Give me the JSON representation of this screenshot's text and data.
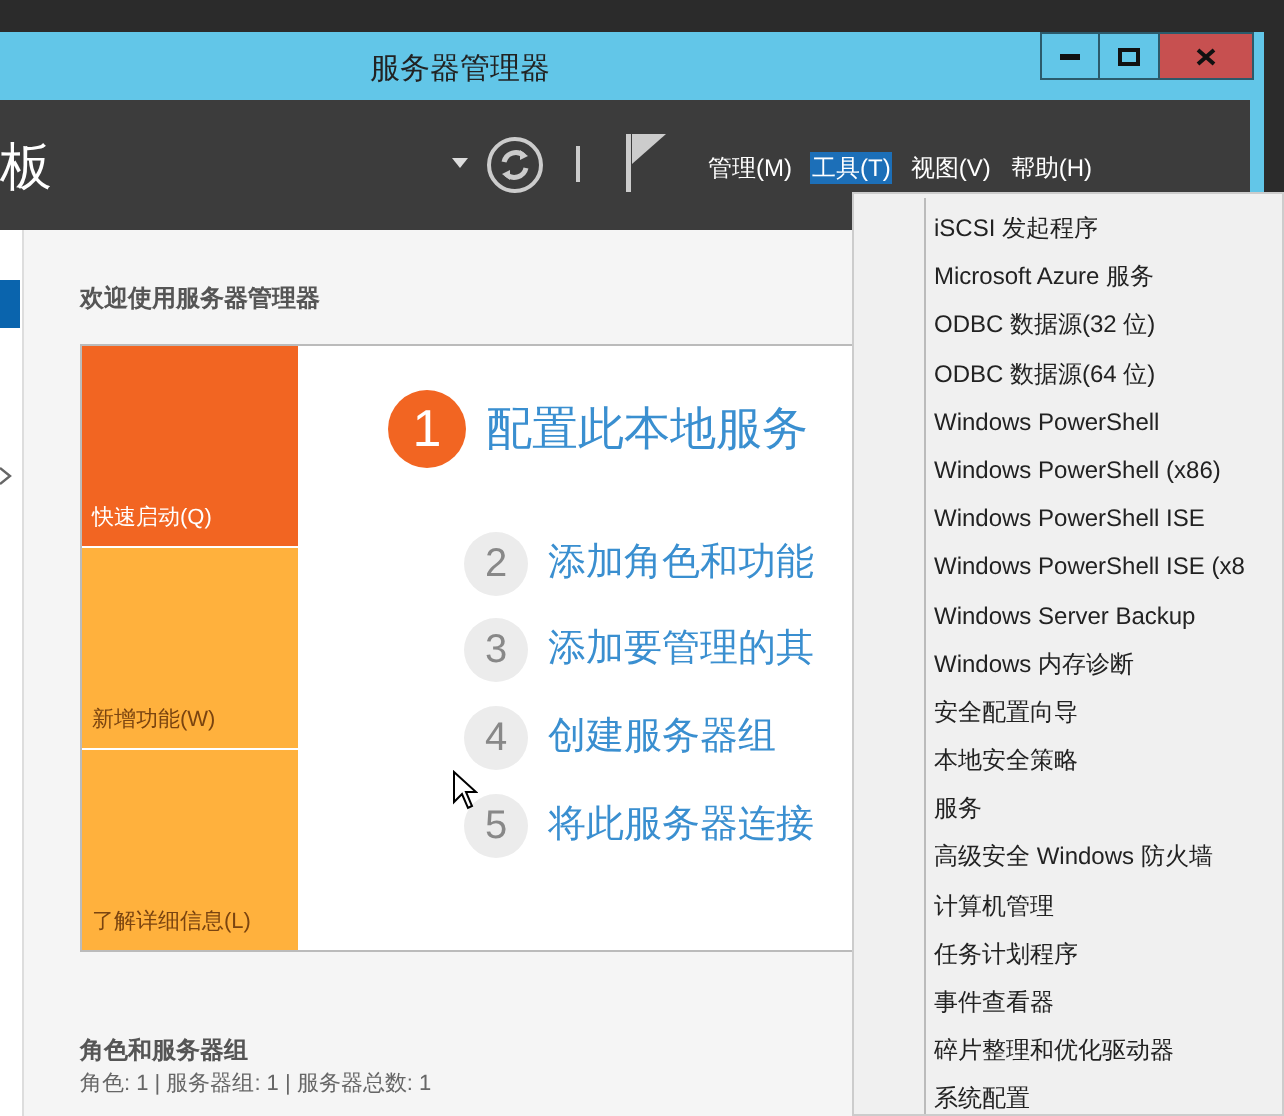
{
  "window": {
    "title": "服务器管理器"
  },
  "header": {
    "title": "板"
  },
  "menu_bar": [
    {
      "label": "管理(M)",
      "selected": false
    },
    {
      "label": "工具(T)",
      "selected": true
    },
    {
      "label": "视图(V)",
      "selected": false
    },
    {
      "label": "帮助(H)",
      "selected": false
    }
  ],
  "welcome": {
    "heading": "欢迎使用服务器管理器",
    "tiles": [
      {
        "label": "快速启动(Q)",
        "selected": true
      },
      {
        "label": "新增功能(W)",
        "selected": false
      },
      {
        "label": "了解详细信息(L)",
        "selected": false
      }
    ],
    "steps": [
      {
        "number": "1",
        "label": "配置此本地服务",
        "current": true
      },
      {
        "number": "2",
        "label": "添加角色和功能",
        "current": false
      },
      {
        "number": "3",
        "label": "添加要管理的其",
        "current": false
      },
      {
        "number": "4",
        "label": "创建服务器组",
        "current": false
      },
      {
        "number": "5",
        "label": "将此服务器连接",
        "current": false
      }
    ]
  },
  "roles": {
    "heading": "角色和服务器组",
    "summary": "角色: 1 | 服务器组: 1 | 服务器总数: 1"
  },
  "tools_menu": {
    "items": [
      "iSCSI 发起程序",
      "Microsoft Azure 服务",
      "ODBC 数据源(32 位)",
      "ODBC 数据源(64 位)",
      "Windows PowerShell",
      "Windows PowerShell (x86)",
      "Windows PowerShell ISE",
      "Windows PowerShell ISE (x8",
      "Windows Server Backup",
      "Windows 内存诊断",
      "安全配置向导",
      "本地安全策略",
      "服务",
      "高级安全 Windows 防火墙",
      "计算机管理",
      "任务计划程序",
      "事件查看器",
      "碎片整理和优化驱动器",
      "系统配置"
    ]
  }
}
